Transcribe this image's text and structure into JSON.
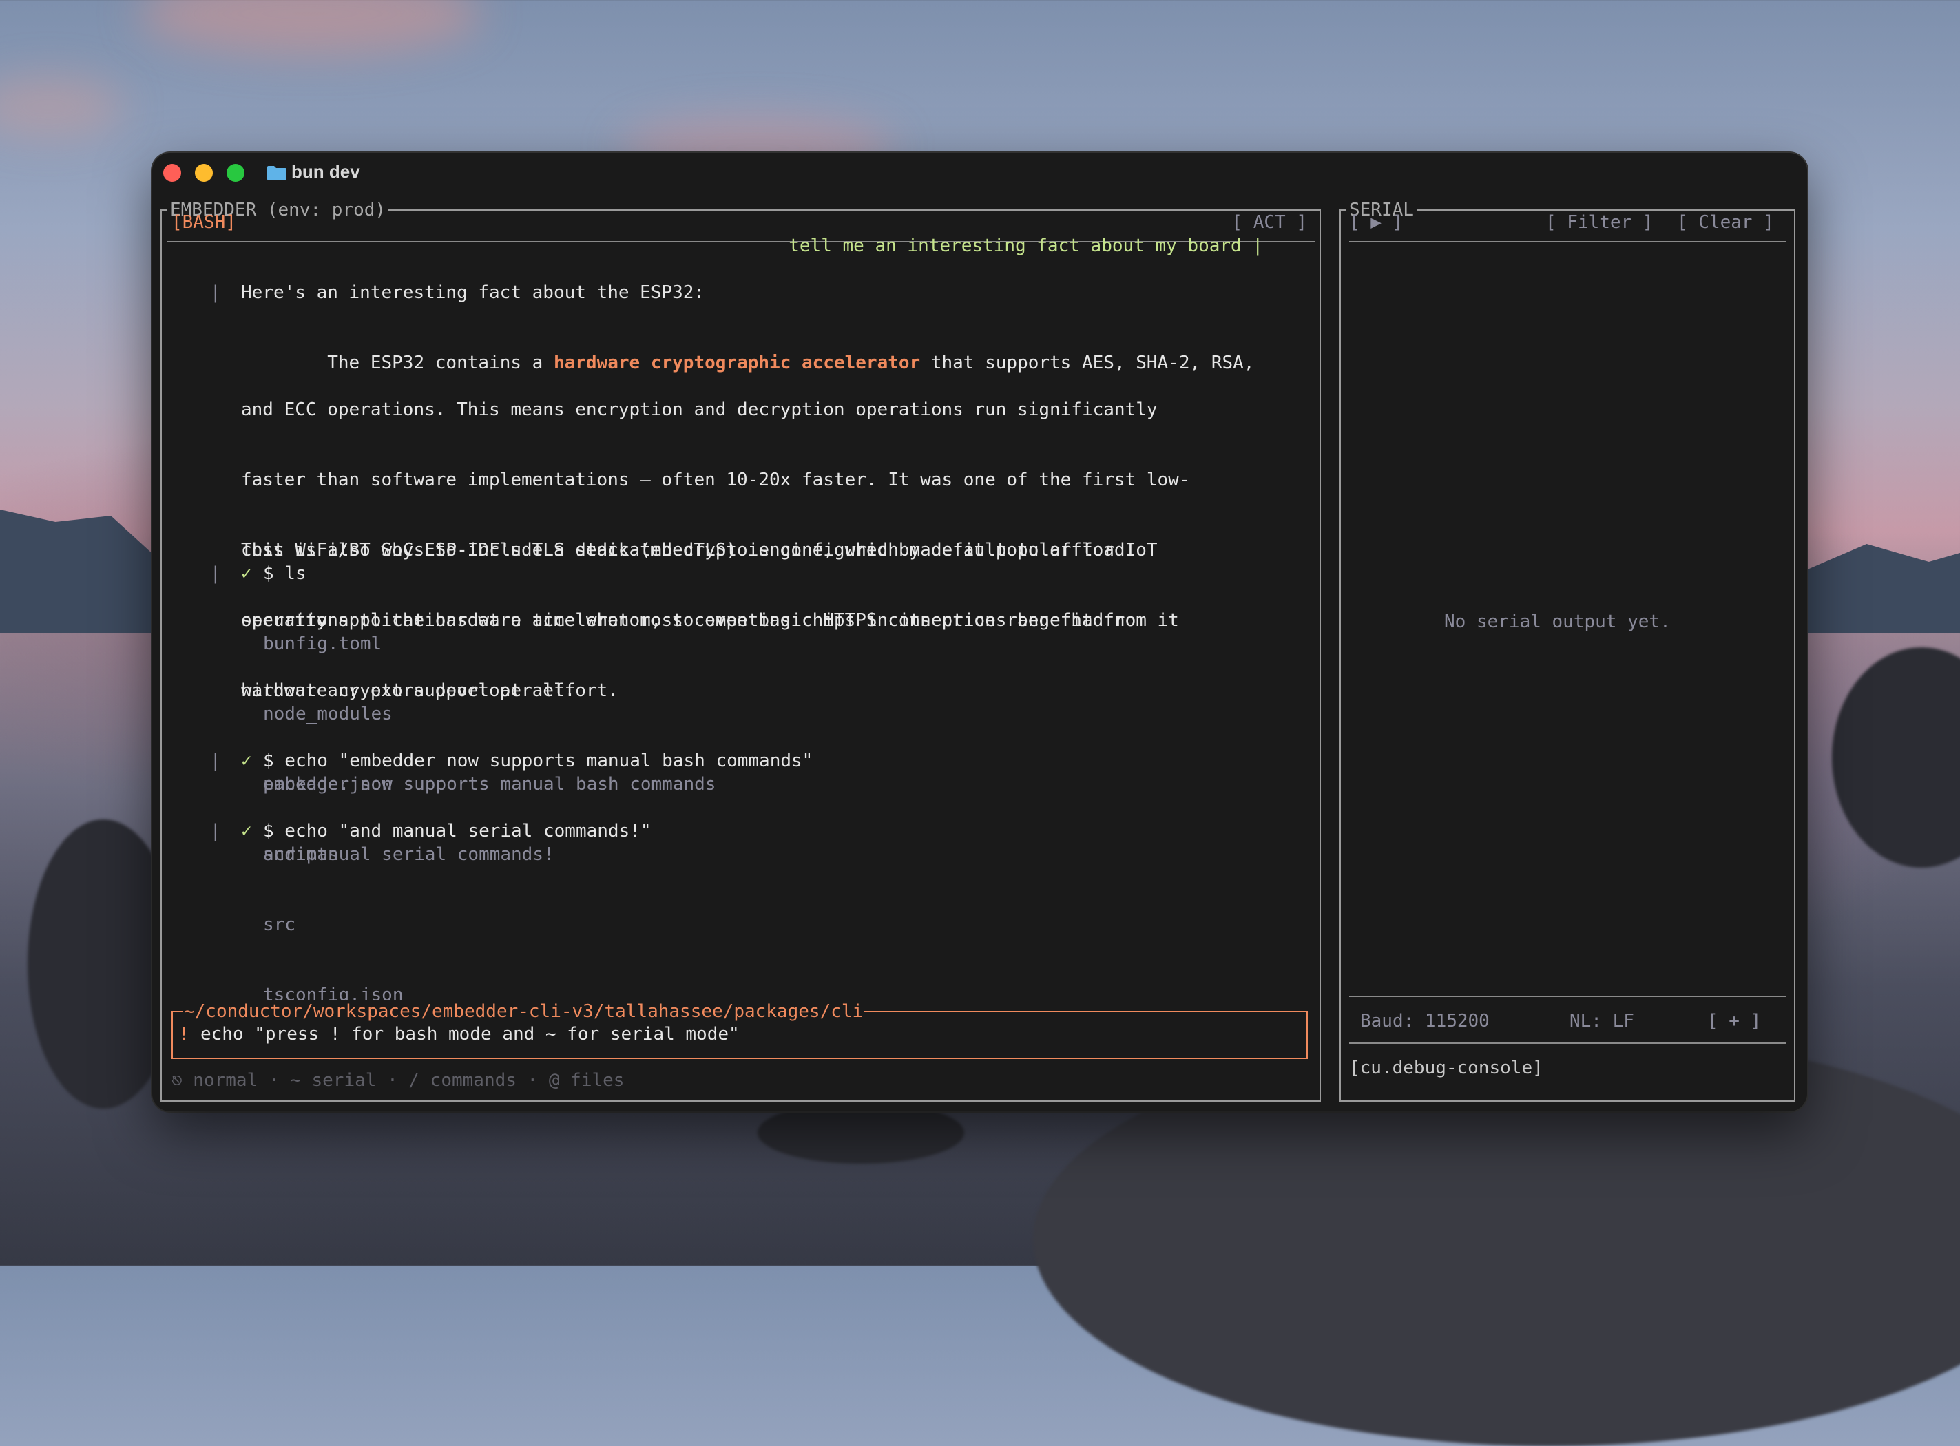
{
  "window": {
    "title": "bun dev",
    "controls": [
      "close",
      "minimize",
      "zoom"
    ]
  },
  "main_pane": {
    "label": "EMBEDDER (env: prod)",
    "mode": "[BASH]",
    "act_button": "[ ACT ]",
    "user_prompt": "tell me an interesting fact about my board |",
    "response": {
      "bar": "|",
      "intro": "Here's an interesting fact about the ESP32:",
      "p1_before": "The ESP32 contains a ",
      "p1_highlight": "hardware cryptographic accelerator",
      "p1_after": " that supports AES, SHA-2, RSA,",
      "p1_lines": [
        "and ECC operations. This means encryption and decryption operations run significantly",
        "faster than software implementations — often 10-20x faster. It was one of the first low-",
        "cost WiFi/BT SoCs to include a dedicated crypto engine, which made it popular for IoT",
        "security applications at a time when most competing chips in its price range had no",
        "hardware crypto support at all."
      ],
      "p2_lines": [
        "This is also why ESP-IDF's TLS stack (mbedTLS) is configured by default to offload",
        "operations to the hardware accelerator, so even basic HTTPS connections benefit from it",
        "without any extra developer effort."
      ]
    },
    "commands": [
      {
        "bar": "|",
        "check": "✓",
        "command": "$ ls",
        "output": [
          "bunfig.toml",
          "node_modules",
          "package.json",
          "scripts",
          "src",
          "tsconfig.json"
        ]
      },
      {
        "bar": "|",
        "check": "✓",
        "command": "$ echo \"embedder now supports manual bash commands\"",
        "output": [
          "embedder now supports manual bash commands"
        ]
      },
      {
        "bar": "|",
        "check": "✓",
        "command": "$ echo \"and manual serial commands!\"",
        "output": [
          "and manual serial commands!"
        ]
      }
    ],
    "input": {
      "path": "~/conductor/workspaces/embedder-cli-v3/tallahassee/packages/cli",
      "prefix": "!",
      "value": "echo \"press ! for bash mode and ~ for serial mode\""
    },
    "hints": "⎋ normal · ~ serial · / commands · @ files"
  },
  "serial_pane": {
    "label": "SERIAL",
    "play_button": "[ ▶ ]",
    "filter_button": "[ Filter ]",
    "clear_button": "[ Clear ]",
    "empty_message": "No serial output yet.",
    "baud": "Baud: 115200",
    "newline": "NL: LF",
    "add_button": "[ + ]",
    "device": "[cu.debug-console]"
  },
  "colors": {
    "accent_orange": "#f08a5d",
    "prompt_green": "#c5e38c",
    "window_bg": "#1a1a1a",
    "light_close": "#ff5f57",
    "light_minimize": "#febc2e",
    "light_zoom": "#28c840",
    "folder_blue": "#5fb3e8"
  }
}
